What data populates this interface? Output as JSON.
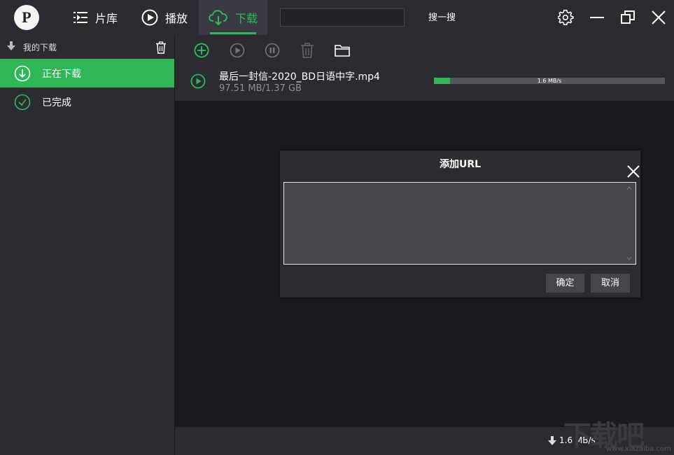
{
  "app": {
    "logo_text": "P"
  },
  "nav": [
    {
      "label": "片库",
      "icon": "library-icon"
    },
    {
      "label": "播放",
      "icon": "play-circle-icon"
    },
    {
      "label": "下载",
      "icon": "cloud-download-icon",
      "active": true
    }
  ],
  "search": {
    "value": "",
    "button_label": "搜一搜"
  },
  "sidebar": {
    "title": "我的下载",
    "items": [
      {
        "label": "正在下载",
        "active": true
      },
      {
        "label": "已完成",
        "active": false
      }
    ]
  },
  "toolbar": [
    "add-icon",
    "play-icon",
    "pause-icon",
    "trash-icon",
    "folder-icon"
  ],
  "downloads": [
    {
      "name": "最后一封信-2020_BD日语中字.mp4",
      "size": "97.51 MB/1.37 GB",
      "speed": "1.6 MB/s",
      "progress": 0.07
    }
  ],
  "status": {
    "speed": "1.6 MB/s"
  },
  "dialog": {
    "title": "添加URL",
    "text_value": "",
    "ok_label": "确定",
    "cancel_label": "取消"
  },
  "watermark": {
    "text": "下载吧",
    "url": "www.xiazaiba.com"
  },
  "colors": {
    "accent": "#2fb757",
    "panel": "#2b2b32",
    "background": "#1b1b1f"
  }
}
